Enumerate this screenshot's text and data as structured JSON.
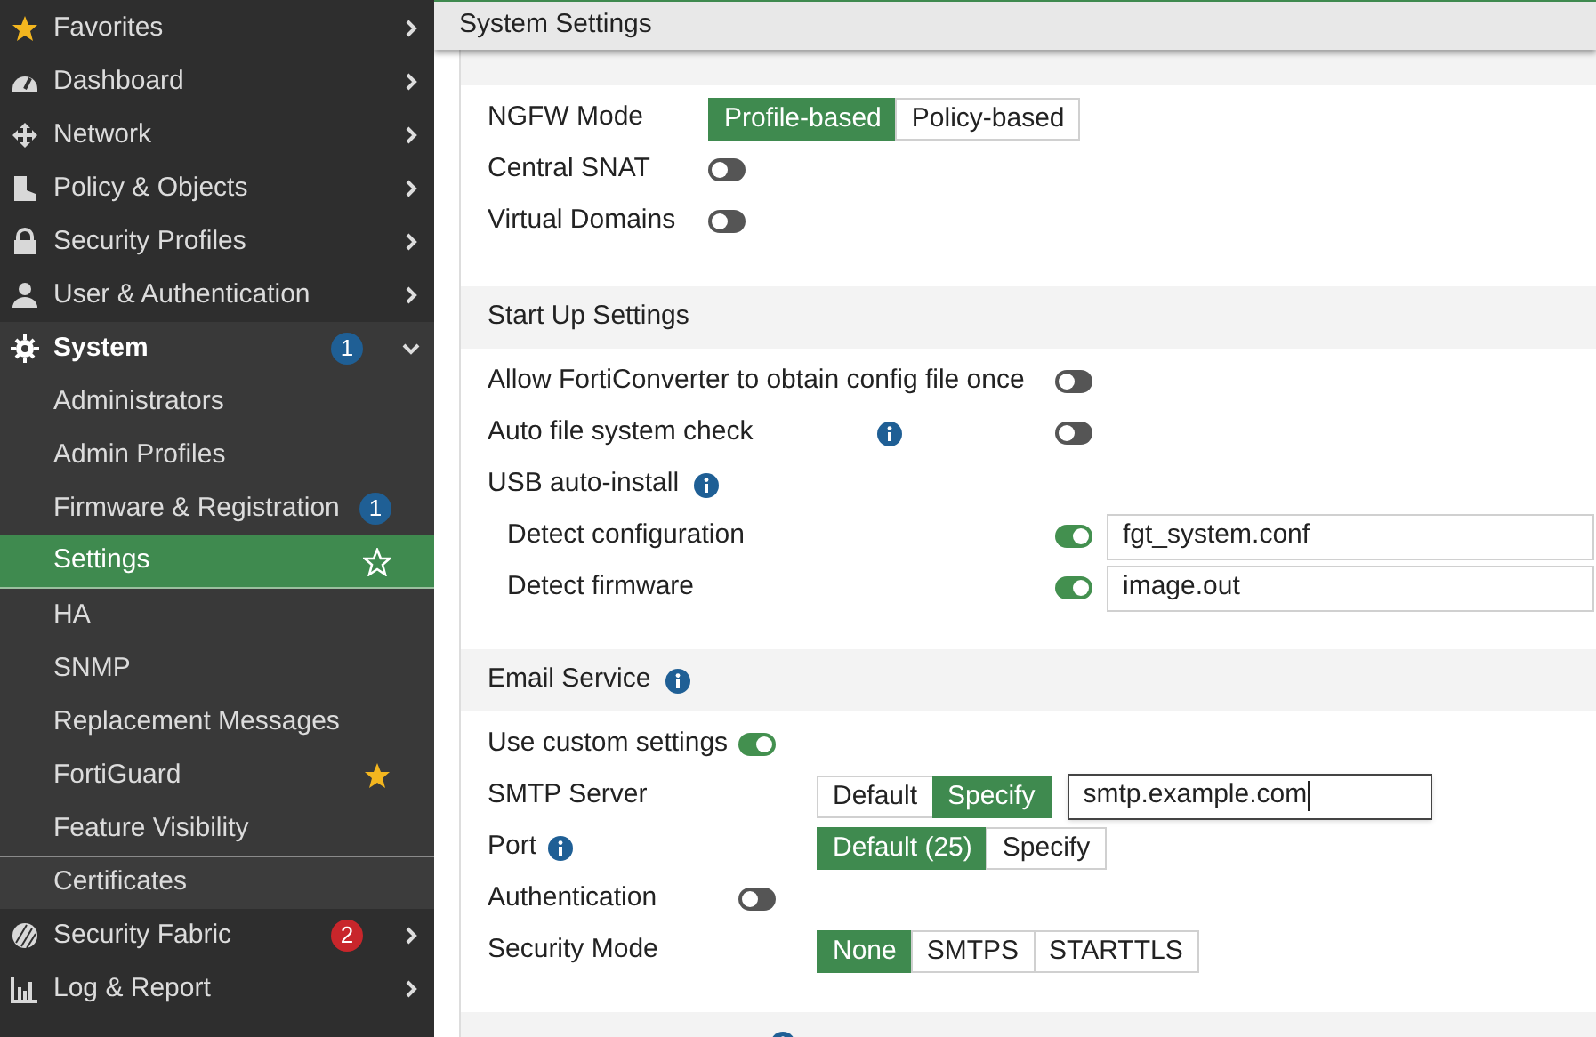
{
  "sidebar": {
    "items": [
      {
        "label": "Favorites",
        "expanded": false
      },
      {
        "label": "Dashboard",
        "expanded": false
      },
      {
        "label": "Network",
        "expanded": false
      },
      {
        "label": "Policy & Objects",
        "expanded": false
      },
      {
        "label": "Security Profiles",
        "expanded": false
      },
      {
        "label": "User & Authentication",
        "expanded": false
      },
      {
        "label": "System",
        "expanded": true,
        "badge": "1",
        "color": "#1f5f95",
        "children": [
          {
            "label": "Administrators",
            "selected": false,
            "starred": false
          },
          {
            "label": "Admin Profiles",
            "selected": false,
            "starred": false
          },
          {
            "label": "Firmware & Registration",
            "selected": false,
            "starred": false,
            "badge": "1",
            "color": "#1f5f95"
          },
          {
            "label": "Settings",
            "selected": true,
            "starred": false
          },
          {
            "label": "HA",
            "selected": false,
            "starred": false
          },
          {
            "label": "SNMP",
            "selected": false,
            "starred": false
          },
          {
            "label": "Replacement Messages",
            "selected": false,
            "starred": false
          },
          {
            "label": "FortiGuard",
            "selected": false,
            "starred": true
          },
          {
            "label": "Feature Visibility",
            "selected": false,
            "starred": false
          },
          {
            "label": "Certificates",
            "selected": false,
            "starred": false
          }
        ]
      },
      {
        "label": "Security Fabric",
        "expanded": false,
        "badge": "2",
        "color": "#c8262b"
      },
      {
        "label": "Log & Report",
        "expanded": false
      }
    ]
  },
  "page_title": "System Settings",
  "sections": [
    {
      "rows": [
        {
          "kind": "segmented",
          "label": "NGFW Mode",
          "options": [
            {
              "label": "Profile-based",
              "selected": true
            },
            {
              "label": "Policy-based",
              "selected": false
            }
          ]
        },
        {
          "kind": "toggle",
          "label": "Central SNAT",
          "on": false
        },
        {
          "kind": "toggle",
          "label": "Virtual Domains",
          "on": false
        }
      ]
    },
    {
      "title": "Start Up Settings",
      "rows": [
        {
          "kind": "toggle",
          "label": "Allow FortiConverter to obtain config file once",
          "on": false
        },
        {
          "kind": "toggle",
          "label": "Auto file system check",
          "on": false,
          "info": true
        },
        {
          "kind": "heading",
          "label": "USB auto-install",
          "info": true
        },
        {
          "kind": "toggle_field",
          "label": "Detect configuration",
          "on": true,
          "value": "fgt_system.conf"
        },
        {
          "kind": "toggle_field",
          "label": "Detect firmware",
          "on": true,
          "value": "image.out"
        }
      ]
    },
    {
      "title": "Email Service",
      "info": true,
      "rows": [
        {
          "kind": "toggle",
          "label": "Use custom settings",
          "on": true
        },
        {
          "kind": "segmented",
          "label": "SMTP Server",
          "options": [
            {
              "label": "Default",
              "selected": false
            },
            {
              "label": "Specify",
              "selected": true
            }
          ],
          "value": "smtp.example.com"
        },
        {
          "kind": "segmented",
          "label": "Port",
          "info": true,
          "options": [
            {
              "label": "Default (25)",
              "selected": true
            },
            {
              "label": "Specify",
              "selected": false
            }
          ]
        },
        {
          "kind": "toggle",
          "label": "Authentication",
          "on": false
        },
        {
          "kind": "segmented",
          "label": "Security Mode",
          "options": [
            {
              "label": "None",
              "selected": true
            },
            {
              "label": "SMTPS",
              "selected": false
            },
            {
              "label": "STARTTLS",
              "selected": false
            }
          ]
        }
      ]
    },
    {
      "info": true
    }
  ]
}
